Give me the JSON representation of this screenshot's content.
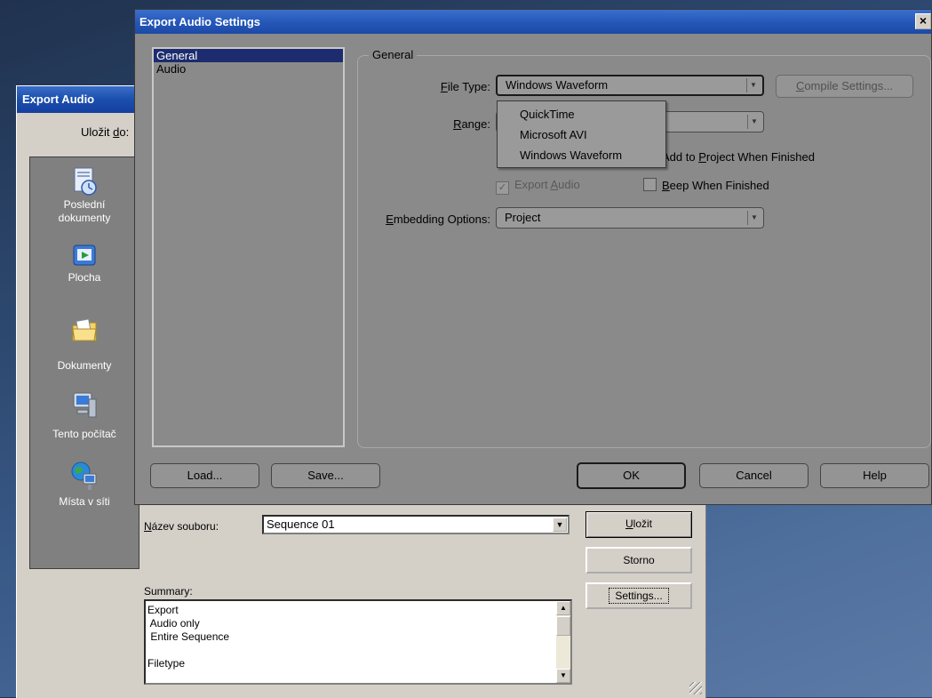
{
  "export_audio": {
    "title": "Export Audio",
    "save_in_label": "Uložit do:",
    "places": [
      {
        "label_line1": "Poslední",
        "label_line2": "dokumenty",
        "icon": "recent-documents-icon"
      },
      {
        "label_line1": "Plocha",
        "label_line2": "",
        "icon": "desktop-icon"
      },
      {
        "label_line1": "Dokumenty",
        "label_line2": "",
        "icon": "my-documents-icon"
      },
      {
        "label_line1": "Tento počítač",
        "label_line2": "",
        "icon": "my-computer-icon"
      },
      {
        "label_line1": "Místa v síti",
        "label_line2": "",
        "icon": "network-places-icon"
      }
    ],
    "filename_label": "Název souboru:",
    "filename_value": "Sequence 01",
    "save_button": "Uložit",
    "cancel_button": "Storno",
    "settings_button": "Settings...",
    "summary_label": "Summary:",
    "summary_lines": [
      "Export",
      " Audio only",
      " Entire Sequence",
      "",
      "Filetype"
    ]
  },
  "settings_dialog": {
    "title": "Export Audio Settings",
    "close_glyph": "×",
    "categories": [
      "General",
      "Audio"
    ],
    "selected_category": "General",
    "group_title": "General",
    "file_type_label": "File Type:",
    "file_type_value": "Windows Waveform",
    "range_label": "Range:",
    "range_value": "",
    "compile_settings_button": "Compile Settings...",
    "file_type_options": [
      "QuickTime",
      "Microsoft AVI",
      "Windows Waveform"
    ],
    "add_to_project_label": "Add to Project When Finished",
    "add_to_project_checked": false,
    "export_audio_label": "Export Audio",
    "export_audio_checked": true,
    "beep_label": "Beep When Finished",
    "beep_checked": false,
    "embedding_label": "Embedding Options:",
    "embedding_value": "Project",
    "load_button": "Load...",
    "save_button": "Save...",
    "ok_button": "OK",
    "cancel_button": "Cancel",
    "help_button": "Help"
  }
}
